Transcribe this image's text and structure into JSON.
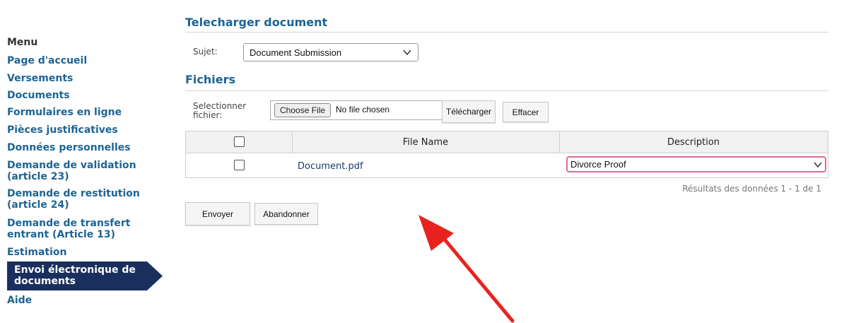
{
  "sidebar": {
    "title": "Menu",
    "items": [
      {
        "label": "Page d'accueil"
      },
      {
        "label": "Versements"
      },
      {
        "label": "Documents"
      },
      {
        "label": "Formulaires en ligne"
      },
      {
        "label": "Pièces justificatives"
      },
      {
        "label": "Données personnelles"
      },
      {
        "label": "Demande de validation (article 23)"
      },
      {
        "label": "Demande de restitution (article 24)"
      },
      {
        "label": "Demande de transfert entrant (Article 13)"
      },
      {
        "label": "Estimation"
      },
      {
        "label": "Envoi électronique de documents",
        "active": true
      },
      {
        "label": "Aide"
      }
    ]
  },
  "upload": {
    "title": "Telecharger document",
    "subject_label": "Sujet:",
    "subject_value": "Document Submission"
  },
  "files": {
    "title": "Fichiers",
    "select_label": "Selectionner fichier:",
    "choose_file_label": "Choose File",
    "no_file_text": "No file chosen",
    "upload_button": "Télécharger",
    "clear_button": "Effacer"
  },
  "table": {
    "headers": {
      "file_name": "File Name",
      "description": "Description"
    },
    "rows": [
      {
        "file_name": "Document.pdf",
        "description": "Divorce Proof",
        "checked": false
      }
    ],
    "results_text": "Résultats des données 1 - 1 de 1"
  },
  "actions": {
    "submit_label": "Envoyer",
    "cancel_label": "Abandonner"
  },
  "colors": {
    "link": "#1d6494",
    "active_nav_bg": "#1b2f5e",
    "description_focus_border": "#e0669a",
    "annotation_arrow": "#e8231f"
  }
}
